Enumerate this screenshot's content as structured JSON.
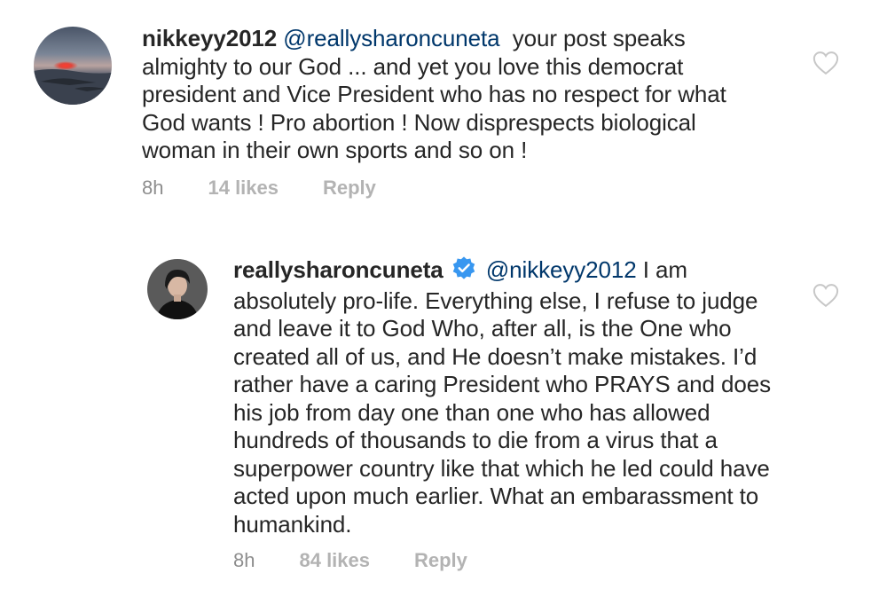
{
  "comments": [
    {
      "username": "nikkeyy2012",
      "mention": "@reallysharoncuneta",
      "text_line1": "  your post speaks",
      "text_rest": "almighty to our God ... and yet you love this democrat president and Vice President who has no respect for what God  wants ! Pro abortion ! Now disprespects biological woman in their own sports and so on !",
      "time": "8h",
      "likes": "14 likes",
      "reply": "Reply"
    },
    {
      "username": "reallysharoncuneta",
      "verified": true,
      "mention": "@nikkeyy2012",
      "text_line1": " I am",
      "text_rest": "absolutely pro-life. Everything else, I refuse to judge and leave it to God Who, after all, is the One who created all of us, and He doesn’t make mistakes. I’d rather have a caring President who PRAYS and does his job from day one than one who has allowed hundreds of thousands to die from a virus that a superpower country like that which he led could have acted upon much earlier. What an embarassment to humankind.",
      "time": "8h",
      "likes": "84 likes",
      "reply": "Reply"
    }
  ],
  "colors": {
    "text": "#262626",
    "mention": "#00376b",
    "meta": "#8e8e8e",
    "meta_bold": "#b3b3b3",
    "heart": "#c7c7c7",
    "verified": "#3897f0"
  },
  "icons": {
    "like": "heart-outline-icon",
    "verified": "verified-badge-icon"
  }
}
